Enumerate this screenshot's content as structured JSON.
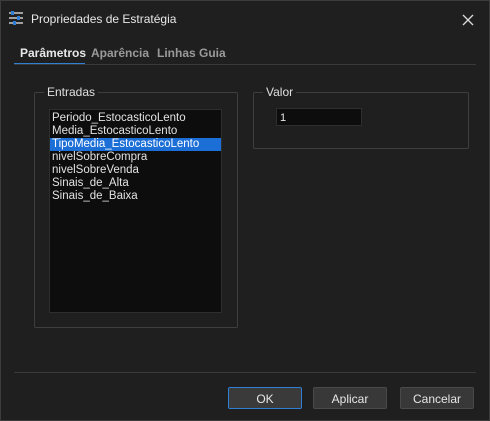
{
  "window": {
    "title": "Propriedades de Estratégia",
    "icon": "sliders-icon"
  },
  "tabs": [
    {
      "label": "Parâmetros",
      "active": true
    },
    {
      "label": "Aparência",
      "active": false
    },
    {
      "label": "Linhas Guia",
      "active": false
    }
  ],
  "entradas": {
    "label": "Entradas",
    "items": [
      "Periodo_EstocasticoLento",
      "Media_EstocasticoLento",
      "TipoMedia_EstocasticoLento",
      "nivelSobreCompra",
      "nivelSobreVenda",
      "Sinais_de_Alta",
      "Sinais_de_Baixa"
    ],
    "selected": "TipoMedia_EstocasticoLento"
  },
  "valor": {
    "label": "Valor",
    "value": "1"
  },
  "buttons": {
    "ok": "OK",
    "aplicar": "Aplicar",
    "cancelar": "Cancelar"
  },
  "colors": {
    "accent": "#2f7fd6",
    "selection": "#1c6fd6",
    "background": "#1f1f1f"
  }
}
